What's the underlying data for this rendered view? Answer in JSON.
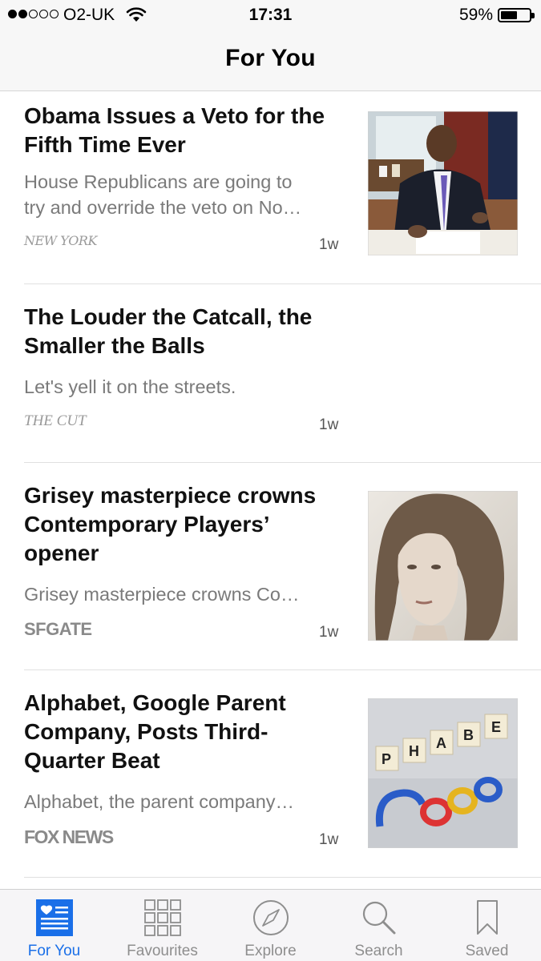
{
  "status_bar": {
    "carrier": "O2-UK",
    "time": "17:31",
    "battery": "59%",
    "battery_level": 0.59
  },
  "nav": {
    "title": "For You"
  },
  "articles": [
    {
      "headline_lines": [
        "Obama Issues a Veto for the",
        "Fifth Time Ever"
      ],
      "summary_lines": [
        "House Republicans are going to",
        "try and override the veto on No…"
      ],
      "source": "NEW YORK",
      "age": "1w"
    },
    {
      "headline_lines": [
        "The Louder the Catcall, the",
        "Smaller the Balls"
      ],
      "summary_lines": [
        "Let's yell it on the streets."
      ],
      "source": "THE CUT",
      "age": "1w"
    },
    {
      "headline_lines": [
        "Grisey masterpiece crowns",
        "Contemporary Players’",
        "opener"
      ],
      "summary_lines": [
        "Grisey masterpiece crowns Co…"
      ],
      "source": "SFGATE",
      "age": "1w"
    },
    {
      "headline_lines": [
        "Alphabet, Google Parent",
        "Company, Posts Third-",
        "Quarter Beat"
      ],
      "summary_lines": [
        "Alphabet, the parent company…"
      ],
      "source": "FOX NEWS",
      "age": "1w"
    }
  ],
  "tabs": [
    {
      "label": "For You",
      "icon": "for-you-icon",
      "active": true
    },
    {
      "label": "Favourites",
      "icon": "favourites-grid-icon",
      "active": false
    },
    {
      "label": "Explore",
      "icon": "compass-icon",
      "active": false
    },
    {
      "label": "Search",
      "icon": "search-icon",
      "active": false
    },
    {
      "label": "Saved",
      "icon": "bookmark-icon",
      "active": false
    }
  ],
  "colors": {
    "accent": "#1a6fe8",
    "inactive": "#8e8e8e"
  }
}
